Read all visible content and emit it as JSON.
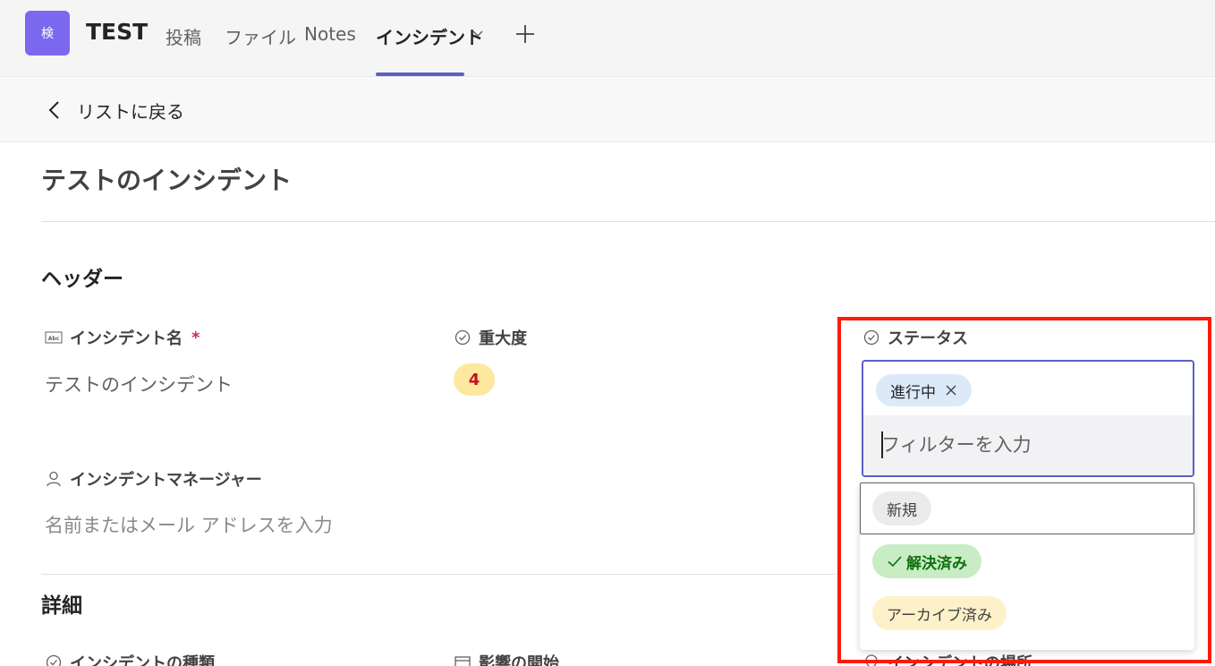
{
  "team": {
    "avatar_text": "検",
    "name": "TEST"
  },
  "tabs": [
    {
      "label": "投稿"
    },
    {
      "label": "ファイル"
    },
    {
      "label": "Notes"
    },
    {
      "label": "インシデント",
      "active": true
    }
  ],
  "back_label": "リストに戻る",
  "page_title": "テストのインシデント",
  "sections": {
    "header": "ヘッダー",
    "details": "詳細"
  },
  "fields": {
    "incident_name": {
      "label": "インシデント名",
      "required_mark": "*",
      "value": "テストのインシデント"
    },
    "severity": {
      "label": "重大度",
      "value": "4"
    },
    "status": {
      "label": "ステータス"
    },
    "incident_manager": {
      "label": "インシデントマネージャー",
      "placeholder": "名前またはメール アドレスを入力"
    },
    "incident_type": {
      "label": "インシデントの種類"
    },
    "impact_start": {
      "label": "影響の開始"
    },
    "incident_location": {
      "label": "インシデントの場所"
    }
  },
  "status_dropdown": {
    "selected": [
      "進行中"
    ],
    "filter_placeholder": "フィルターを入力",
    "options": [
      {
        "label": "新規",
        "focused": true
      },
      {
        "label": "解決済み",
        "checked": true
      },
      {
        "label": "アーカイブ済み"
      }
    ]
  },
  "colors": {
    "accent": "#5b5fc7",
    "highlight_border": "#ff1a0a",
    "severity_badge": "#fde8a0",
    "chip_selected": "#dce9f9",
    "chip_resolved": "#c8ecc4",
    "chip_archived": "#fdf1c9"
  }
}
